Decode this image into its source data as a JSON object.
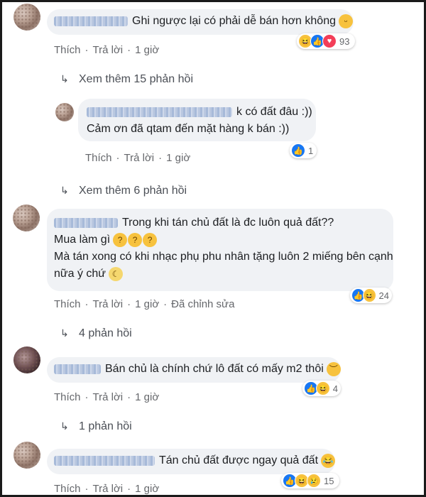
{
  "comments": [
    {
      "text": "Ghi ngược lại có phải dễ bán hơn không",
      "emoji": "smile-emoji",
      "actions": {
        "like": "Thích",
        "reply": "Trả lời",
        "time": "1 giờ",
        "edited": ""
      },
      "reactions": {
        "icons": [
          "haha",
          "like",
          "love"
        ],
        "count": "93"
      }
    },
    {
      "line1": "k có đất đâu :))",
      "line2": "Cảm ơn đã qtam đến mặt hàng k bán :))",
      "actions": {
        "like": "Thích",
        "reply": "Trả lời",
        "time": "1 giờ"
      },
      "reactions": {
        "icons": [
          "like"
        ],
        "count": "1"
      }
    },
    {
      "line1": "Trong khi tán chủ đất là đc luôn quả đất??",
      "line2": "Mua làm gì",
      "line3": "Mà tán xong có khi nhạc phụ phu nhân tặng luôn 2 miếng bên cạnh",
      "line4": "nữa ý chứ",
      "actions": {
        "like": "Thích",
        "reply": "Trả lời",
        "time": "1 giờ",
        "edited": "Đã chỉnh sửa"
      },
      "reactions": {
        "icons": [
          "like",
          "haha"
        ],
        "count": "24"
      }
    },
    {
      "text": "Bán chủ là chính chứ lô đất có mấy m2 thôi",
      "actions": {
        "like": "Thích",
        "reply": "Trả lời",
        "time": "1 giờ"
      },
      "reactions": {
        "icons": [
          "like",
          "haha"
        ],
        "count": "4"
      }
    },
    {
      "text": "Tán chủ đất được ngay quả đất",
      "actions": {
        "like": "Thích",
        "reply": "Trả lời",
        "time": "1 giờ"
      },
      "reactions": {
        "icons": [
          "like",
          "haha",
          "sad"
        ],
        "count": "15"
      }
    }
  ],
  "view_more": {
    "first": "Xem thêm 15 phản hồi",
    "second": "Xem thêm 6 phản hồi",
    "third": "4 phản hồi",
    "fourth": "1 phản hồi"
  }
}
